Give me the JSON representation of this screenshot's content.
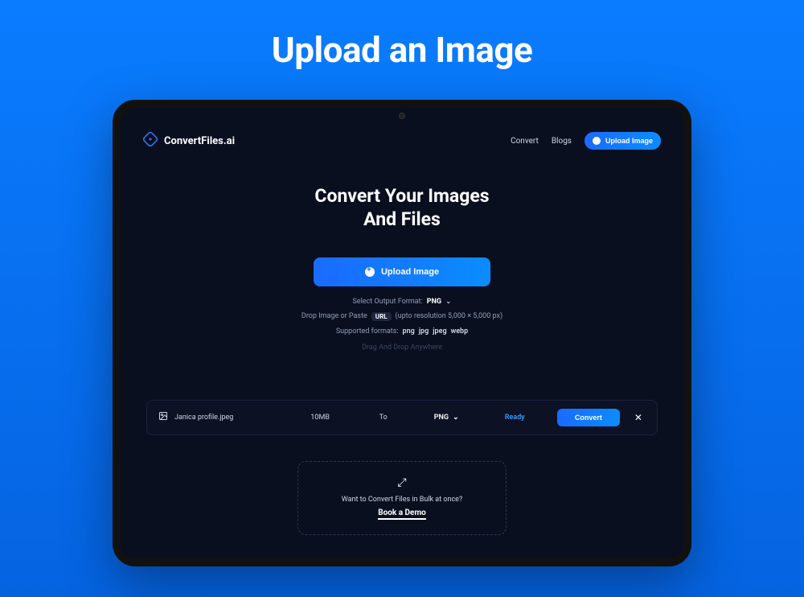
{
  "page": {
    "title": "Upload an Image"
  },
  "header": {
    "brand": "ConvertFiles.ai",
    "nav": {
      "convert": "Convert",
      "blogs": "Blogs"
    },
    "upload_btn": "Upload Image"
  },
  "hero": {
    "line1": "Convert Your Images",
    "line2": "And Files",
    "upload_btn": "Upload Image",
    "select_format_label": "Select Output Format:",
    "selected_format": "PNG",
    "drop_prefix": "Drop Image or Paste",
    "url_pill": "URL",
    "drop_suffix": "(upto resolution 5,000 × 5,000 px)",
    "supported_label": "Supported formats:",
    "formats": [
      "png",
      "jpg",
      "jpeg",
      "webp"
    ],
    "dnd": "Drag And Drop Anywhere"
  },
  "file": {
    "name": "Janica profile.jpeg",
    "size": "10MB",
    "to_label": "To",
    "target_format": "PNG",
    "status": "Ready",
    "convert_btn": "Convert",
    "close": "✕"
  },
  "demo": {
    "question": "Want to Convert Files in Bulk at once?",
    "cta": "Book a Demo"
  }
}
